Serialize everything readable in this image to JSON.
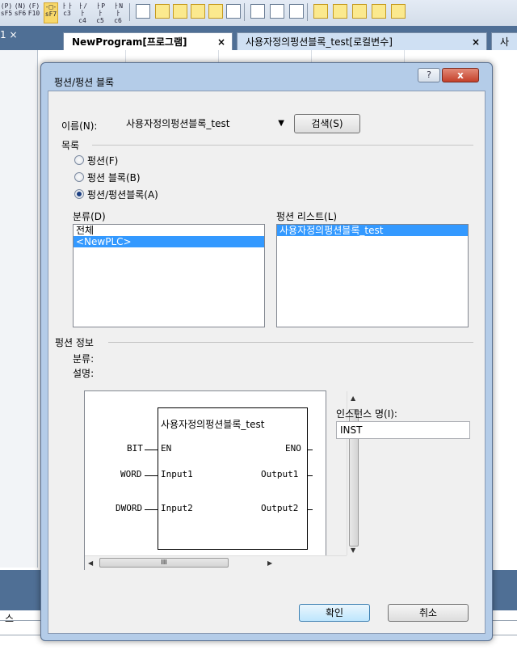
{
  "toolbar": {
    "keys": [
      {
        "top": "(P)",
        "bot": "sF5"
      },
      {
        "top": "(N)",
        "bot": "sF6"
      },
      {
        "top": "(F)",
        "bot": "F10"
      },
      {
        "top": "-□-",
        "bot": "sF7"
      },
      {
        "top": "ㅏㅏ",
        "bot": "c3"
      },
      {
        "top": "ㅏ/ㅏ",
        "bot": "c4"
      },
      {
        "top": "ㅏPㅏ",
        "bot": "c5"
      },
      {
        "top": "ㅏNㅏ",
        "bot": "c6"
      }
    ]
  },
  "tabs": {
    "left_close": "1 ×",
    "active": "NewProgram[프로그램]",
    "inactive": "사용자정의펑션블록_test[로컬변수]",
    "more": "사",
    "close": "×"
  },
  "dialog": {
    "title": "펑션/펑션 블록",
    "help_label": "?",
    "close_label": "x",
    "name_label": "이름(N):",
    "name_value": "사용자정의펑션블록_test",
    "search_label": "검색(S)",
    "list_section": "목록",
    "radios": [
      {
        "label": "펑션(F)",
        "checked": false
      },
      {
        "label": "펑션 블록(B)",
        "checked": false
      },
      {
        "label": "펑션/펑션블록(A)",
        "checked": true
      }
    ],
    "category_label": "분류(D)",
    "category_items": [
      "전체",
      "<NewPLC>"
    ],
    "function_list_label": "펑션 리스트(L)",
    "function_items": [
      "사용자정의펑션블록_test"
    ],
    "info_section": "펑션 정보",
    "info_category": "분류:",
    "info_desc": "설명:",
    "instance_label": "인스턴스 명(I):",
    "instance_value": "INST",
    "ok_label": "확인",
    "cancel_label": "취소"
  },
  "function_block": {
    "title": "사용자정의펑션블록_test",
    "inputs": [
      {
        "var": "BIT",
        "pin": "EN"
      },
      {
        "var": "WORD",
        "pin": "Input1"
      },
      {
        "var": "DWORD",
        "pin": "Input2"
      }
    ],
    "outputs": [
      "ENO",
      "Output1",
      "Output2"
    ],
    "scroll_grip": "III"
  },
  "bottom": {
    "cell_text": "스"
  }
}
